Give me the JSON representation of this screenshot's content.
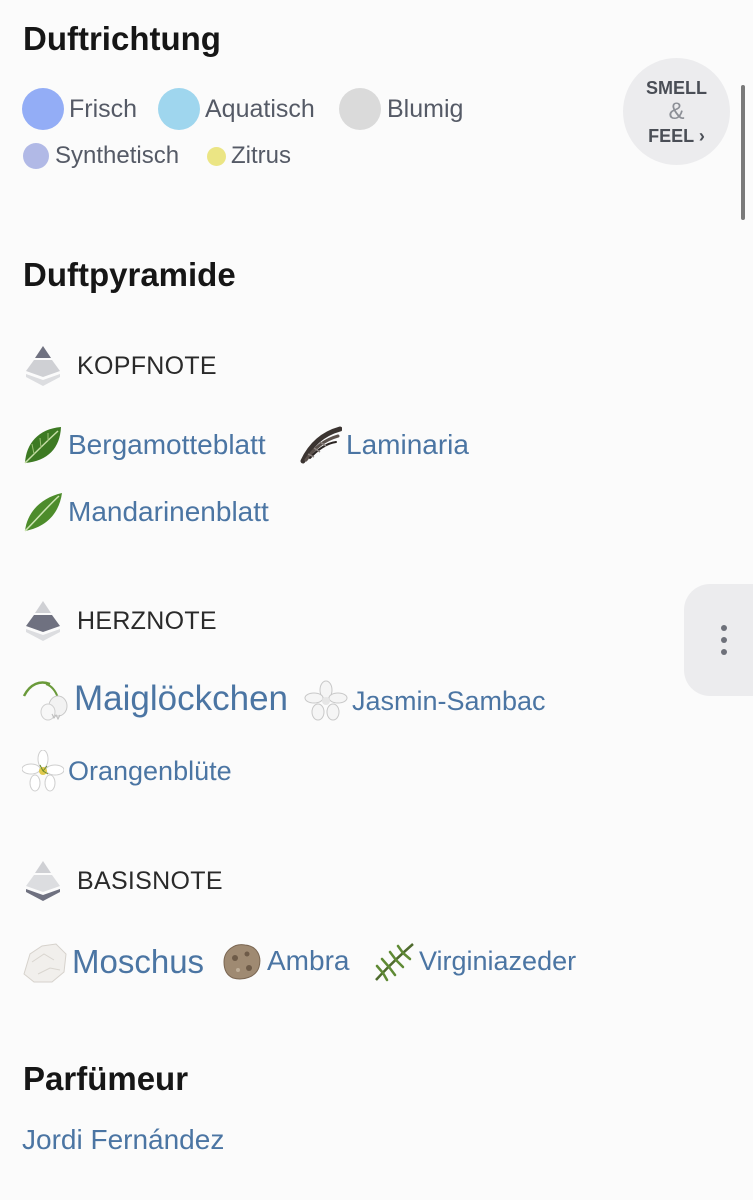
{
  "accords": {
    "title": "Duftrichtung",
    "items": [
      {
        "label": "Frisch",
        "color": "#93adf6"
      },
      {
        "label": "Aquatisch",
        "color": "#9fd6ee"
      },
      {
        "label": "Blumig",
        "color": "#dadada"
      },
      {
        "label": "Synthetisch",
        "color": "#b1b9e6"
      },
      {
        "label": "Zitrus",
        "color": "#ebe584"
      }
    ]
  },
  "smell_feel": {
    "line1": "SMELL",
    "amp": "&",
    "line2": "FEEL ›"
  },
  "pyramid": {
    "title": "Duftpyramide",
    "top": {
      "label": "KOPFNOTE",
      "notes": [
        {
          "name": "Bergamotteblatt",
          "icon": "leaf-icon"
        },
        {
          "name": "Laminaria",
          "icon": "seaweed-icon"
        },
        {
          "name": "Mandarinenblatt",
          "icon": "leaf-icon"
        }
      ]
    },
    "heart": {
      "label": "HERZNOTE",
      "notes": [
        {
          "name": "Maiglöckchen",
          "icon": "lily-of-the-valley-icon"
        },
        {
          "name": "Jasmin-Sambac",
          "icon": "jasmine-flower-icon"
        },
        {
          "name": "Orangenblüte",
          "icon": "orange-blossom-icon"
        }
      ]
    },
    "base": {
      "label": "BASISNOTE",
      "notes": [
        {
          "name": "Moschus",
          "icon": "musk-crystal-icon"
        },
        {
          "name": "Ambra",
          "icon": "ambergris-stone-icon"
        },
        {
          "name": "Virginiazeder",
          "icon": "cedar-branch-icon"
        }
      ]
    }
  },
  "perfumer": {
    "title": "Parfümeur",
    "name": "Jordi Fernández"
  },
  "colors": {
    "link": "#4b75a3",
    "background": "#fbfbfb"
  }
}
